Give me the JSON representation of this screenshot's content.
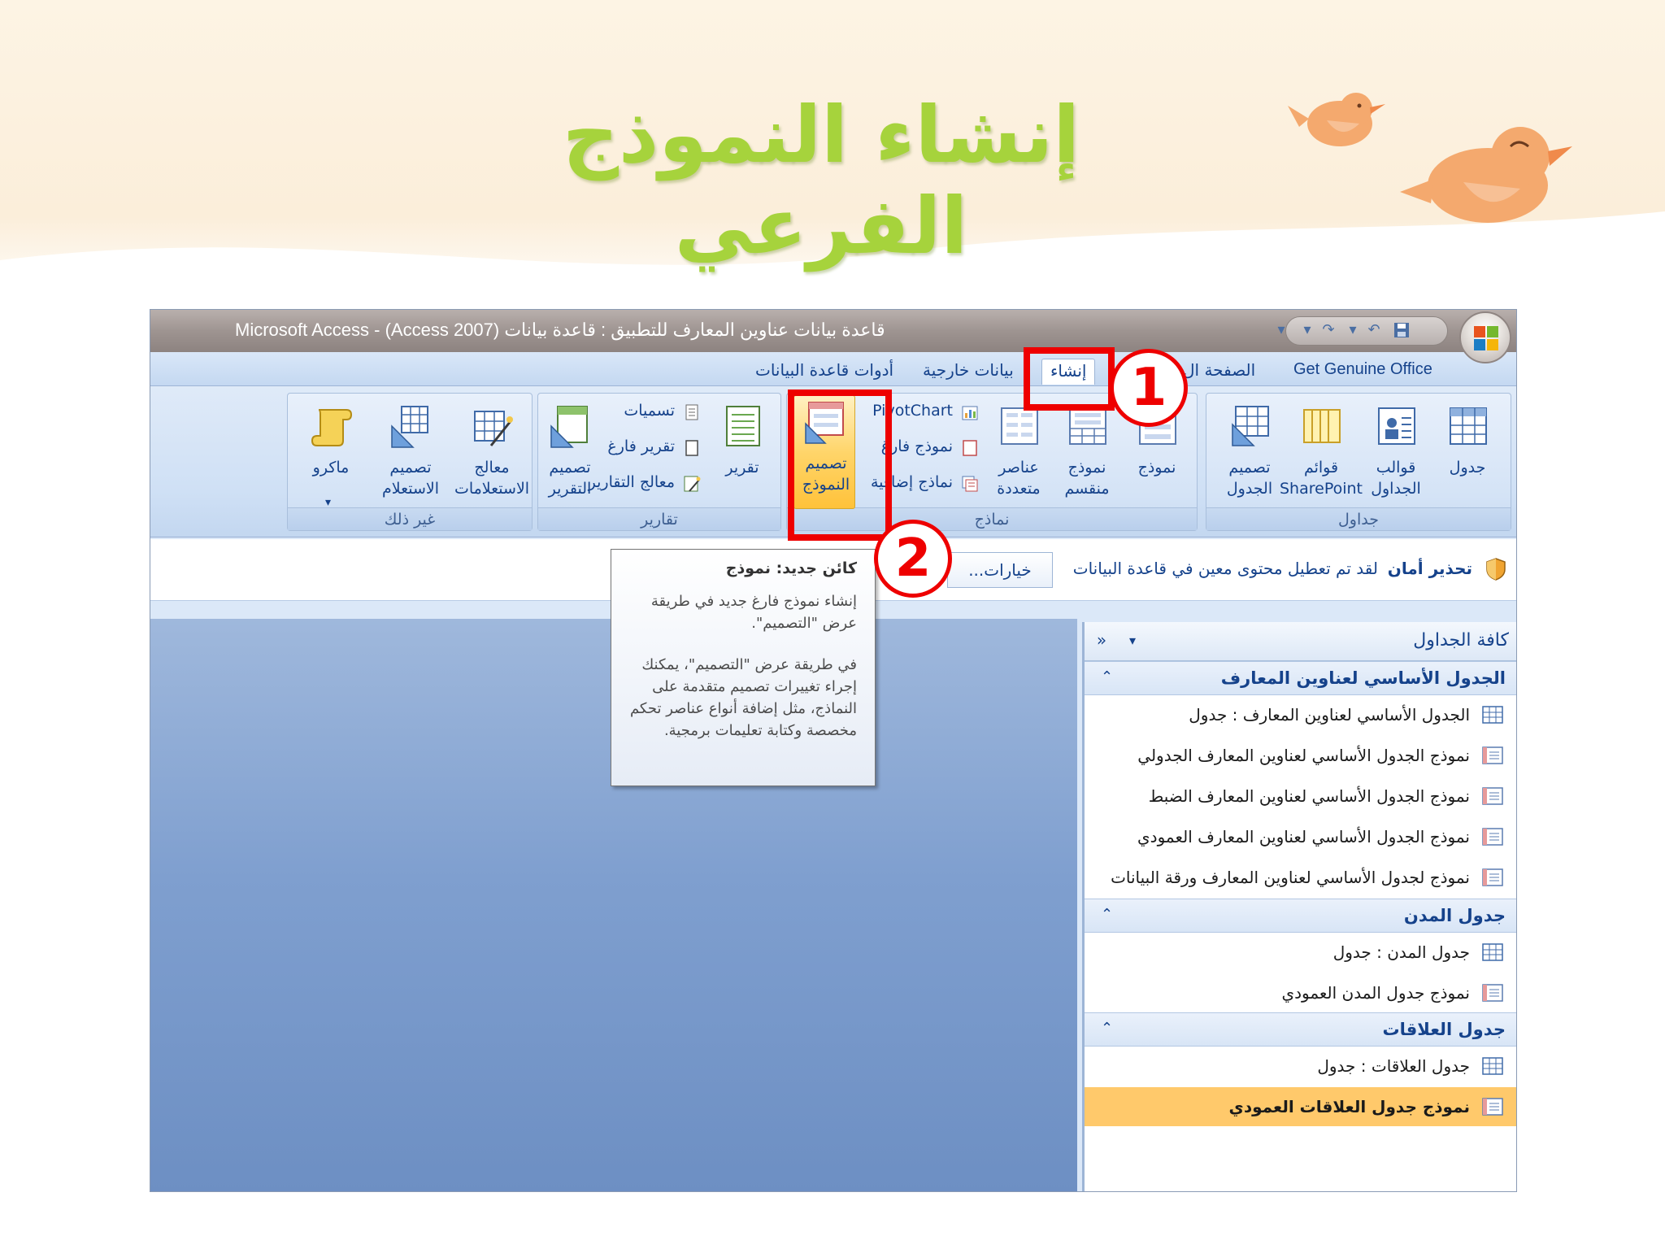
{
  "slide": {
    "title": "إنشاء النموذج الفرعي"
  },
  "window": {
    "title": "Microsoft Access - (Access 2007) قاعدة بيانات عناوين المعارف للتطبيق : قاعدة بيانات"
  },
  "tabs": [
    {
      "label": "Get Genuine Office",
      "active": false
    },
    {
      "label": "الصفحة ال",
      "active": false
    },
    {
      "label": "إنشاء",
      "active": true
    },
    {
      "label": "بيانات خارجية",
      "active": false
    },
    {
      "label": "أدوات قاعدة البيانات",
      "active": false
    }
  ],
  "ribbon": {
    "tables_group": {
      "label": "جداول",
      "table": "جدول",
      "table_templates": "قوالب الجداول",
      "sharepoint_lists": "قوائم SharePoint",
      "table_design": "تصميم الجدول"
    },
    "forms_group": {
      "label": "نماذج",
      "form": "نموذج",
      "split_form": "نموذج منقسم",
      "multiple_items": "عناصر متعددة",
      "pivotchart": "PivotChart",
      "blank_form": "نموذج فارغ",
      "more_forms": "نماذج إضافية",
      "form_design": "تصميم النموذج"
    },
    "reports_group": {
      "label": "تقارير",
      "report": "تقرير",
      "labels": "تسميات",
      "blank_report": "تقرير فارغ",
      "report_wizard": "معالج التقارير",
      "report_design": "تصميم التقرير"
    },
    "other_group": {
      "label": "غير ذلك",
      "query_wizard": "معالج الاستعلامات",
      "query_design": "تصميم الاستعلام",
      "macro": "ماكرو"
    }
  },
  "message_bar": {
    "title": "تحذير أمان",
    "text": "لقد تم تعطيل محتوى معين في قاعدة البيانات",
    "options_button": "خيارات..."
  },
  "tooltip": {
    "title": "كائن جديد: نموذج",
    "paragraph1": "إنشاء نموذج فارغ جديد في طريقة عرض \"التصميم\".",
    "paragraph2": "في طريقة عرض \"التصميم\"، يمكنك إجراء تغييرات تصميم متقدمة على النماذج، مثل إضافة أنواع عناصر تحكم مخصصة وكتابة تعليمات برمجية."
  },
  "nav_pane": {
    "title": "كافة الجداول",
    "groups": [
      {
        "title": "الجدول الأساسي لعناوين المعارف",
        "items": [
          {
            "label": "الجدول الأساسي لعناوين المعارف : جدول",
            "type": "table",
            "selected": false
          },
          {
            "label": "نموذج الجدول الأساسي لعناوين المعارف الجدولي",
            "type": "form",
            "selected": false
          },
          {
            "label": "نموذج الجدول الأساسي لعناوين المعارف الضبط",
            "type": "form",
            "selected": false
          },
          {
            "label": "نموذج الجدول الأساسي لعناوين المعارف العمودي",
            "type": "form",
            "selected": false
          },
          {
            "label": "نموذج لجدول الأساسي لعناوين المعارف ورقة البيانات",
            "type": "form",
            "selected": false
          }
        ]
      },
      {
        "title": "جدول المدن",
        "items": [
          {
            "label": "جدول المدن : جدول",
            "type": "table",
            "selected": false
          },
          {
            "label": "نموذج جدول المدن العمودي",
            "type": "form",
            "selected": false
          }
        ]
      },
      {
        "title": "جدول العلاقات",
        "items": [
          {
            "label": "جدول العلاقات : جدول",
            "type": "table",
            "selected": false
          },
          {
            "label": "نموذج جدول العلاقات العمودي",
            "type": "form",
            "selected": true
          }
        ]
      }
    ]
  },
  "callouts": [
    {
      "number": "1",
      "target": "create-tab"
    },
    {
      "number": "2",
      "target": "form-design-button"
    }
  ],
  "colors": {
    "title_green": "#a6d33c",
    "callout_red": "#ee0000",
    "selected_item": "#ffc96b",
    "ribbon_text": "#15428b"
  },
  "icons": {
    "table": "table-icon",
    "form": "form-icon",
    "shield": "shield-icon"
  }
}
